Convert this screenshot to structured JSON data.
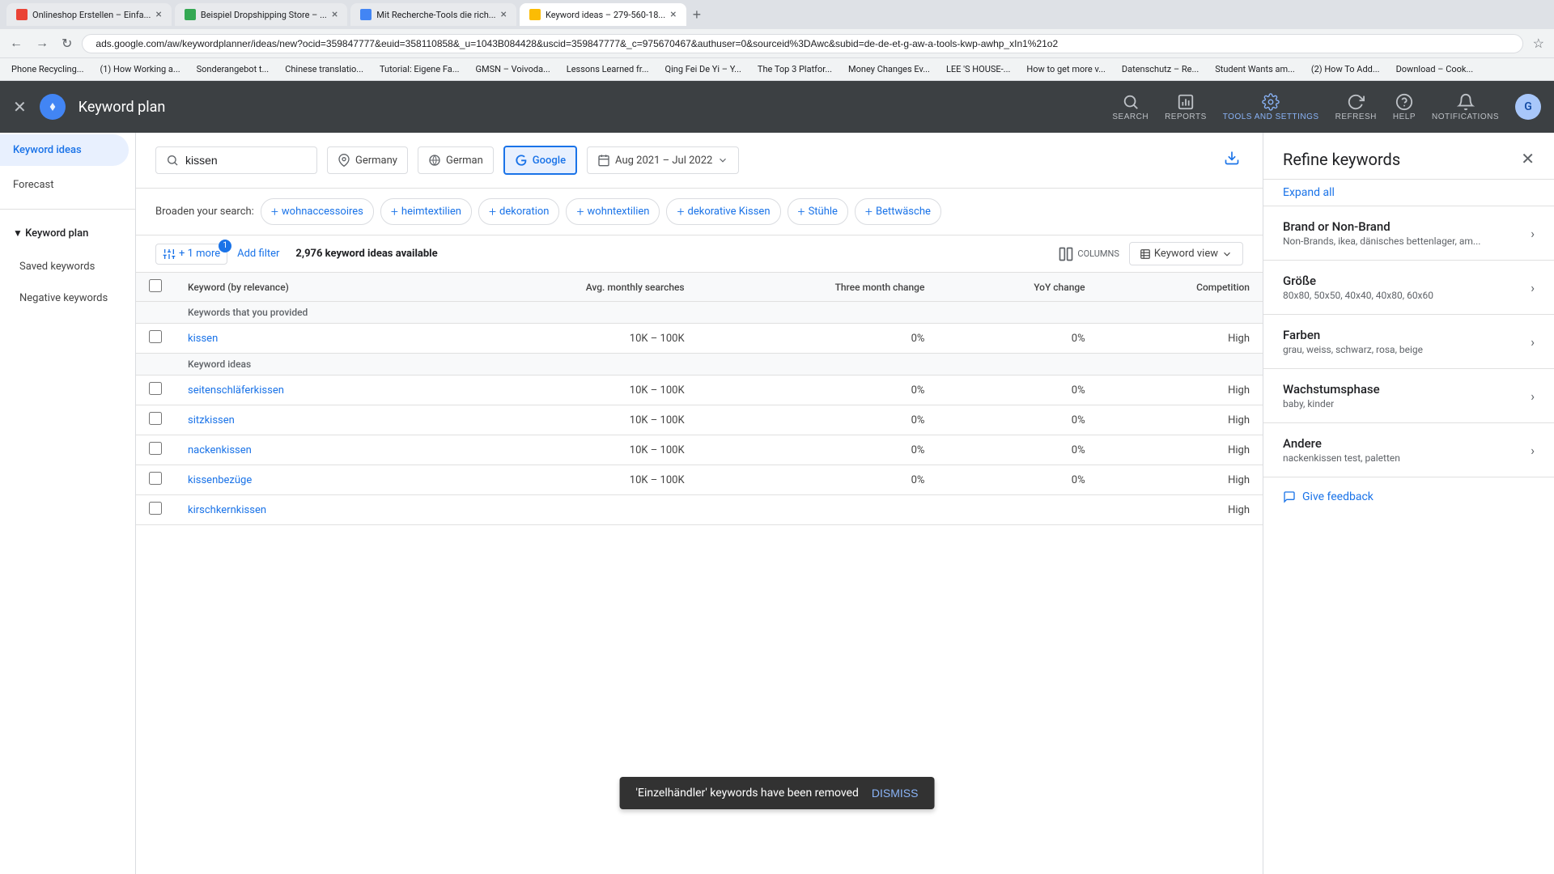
{
  "browser": {
    "tabs": [
      {
        "id": "tab1",
        "title": "Onlineshop Erstellen – Einfa...",
        "active": false
      },
      {
        "id": "tab2",
        "title": "Beispiel Dropshipping Store – ...",
        "active": false
      },
      {
        "id": "tab3",
        "title": "Mit Recherche-Tools die rich...",
        "active": false
      },
      {
        "id": "tab4",
        "title": "Keyword ideas – 279-560-18...",
        "active": true
      }
    ],
    "address": "ads.google.com/aw/keywordplanner/ideas/new?ocid=359847777&euid=358110858&_u=1043B084428&uscid=359847777&_c=975670467&authuser=0&sourceid%3DAwc&subid=de-de-et-g-aw-a-tools-kwp-awhp_xIn1%21o2",
    "bookmarks": [
      "Phone Recycling...",
      "(1) How Working a...",
      "Sonderangebot t...",
      "Chinese translatio...",
      "Tutorial: Eigene Fa...",
      "GMSN – Voivoda...",
      "Lessons Learned fr...",
      "Qing Fei De Yi – Y...",
      "The Top 3 Platfor...",
      "Money Changes Ev...",
      "LEE 'S HOUSE-...",
      "How to get more v...",
      "Datenschutz – Re...",
      "Student Wants am...",
      "(2) How To Add...",
      "Download – Cook..."
    ]
  },
  "header": {
    "title": "Keyword plan",
    "nav": [
      {
        "id": "search",
        "label": "SEARCH"
      },
      {
        "id": "reports",
        "label": "REPORTS"
      },
      {
        "id": "tools",
        "label": "TOOLS AND SETTINGS"
      },
      {
        "id": "refresh",
        "label": "REFRESH"
      },
      {
        "id": "help",
        "label": "HELP"
      },
      {
        "id": "notifications",
        "label": "NOTIFICATIONS"
      }
    ]
  },
  "sidebar": {
    "items": [
      {
        "id": "keyword-ideas",
        "label": "Keyword ideas",
        "active": true
      },
      {
        "id": "forecast",
        "label": "Forecast"
      },
      {
        "id": "keyword-plan",
        "label": "Keyword plan",
        "parent": true
      },
      {
        "id": "saved-keywords",
        "label": "Saved keywords"
      },
      {
        "id": "negative-keywords",
        "label": "Negative keywords"
      }
    ]
  },
  "search_bar": {
    "query": "kissen",
    "location": "Germany",
    "language": "German",
    "network": "Google",
    "date_range": "Aug 2021 – Jul 2022"
  },
  "broaden": {
    "label": "Broaden your search:",
    "tags": [
      "wohnaccessoires",
      "heimtextilien",
      "dekoration",
      "wohntextilien",
      "dekorative Kissen",
      "Stühle",
      "Bettwäsche"
    ]
  },
  "table": {
    "toolbar": {
      "filter_label": "+ 1 more",
      "add_filter": "Add filter",
      "keyword_count": "2,976 keyword ideas available",
      "columns_label": "COLUMNS",
      "view_label": "Keyword view"
    },
    "columns": [
      {
        "id": "keyword",
        "label": "Keyword (by relevance)"
      },
      {
        "id": "avg_monthly",
        "label": "Avg. monthly searches"
      },
      {
        "id": "three_month",
        "label": "Three month change"
      },
      {
        "id": "yoy",
        "label": "YoY change"
      },
      {
        "id": "competition",
        "label": "Competition"
      }
    ],
    "sections": [
      {
        "section_label": "Keywords that you provided",
        "rows": [
          {
            "keyword": "kissen",
            "avg_monthly": "10K – 100K",
            "three_month": "0%",
            "yoy": "0%",
            "competition": "High"
          }
        ]
      },
      {
        "section_label": "Keyword ideas",
        "rows": [
          {
            "keyword": "seitenschläferkissen",
            "avg_monthly": "10K – 100K",
            "three_month": "0%",
            "yoy": "0%",
            "competition": "High"
          },
          {
            "keyword": "sitzkissen",
            "avg_monthly": "10K – 100K",
            "three_month": "0%",
            "yoy": "0%",
            "competition": "High"
          },
          {
            "keyword": "nackenkissen",
            "avg_monthly": "10K – 100K",
            "three_month": "0%",
            "yoy": "0%",
            "competition": "High"
          },
          {
            "keyword": "kissenbezüge",
            "avg_monthly": "10K – 100K",
            "three_month": "0%",
            "yoy": "0%",
            "competition": "High"
          },
          {
            "keyword": "kirschkernkissen",
            "avg_monthly": "",
            "three_month": "",
            "yoy": "",
            "competition": "High"
          }
        ]
      }
    ]
  },
  "refine_panel": {
    "title": "Refine keywords",
    "expand_all": "Expand all",
    "sections": [
      {
        "id": "brand",
        "title": "Brand or Non-Brand",
        "sub": "Non-Brands, ikea, dänisches bettenlager, am..."
      },
      {
        "id": "groesse",
        "title": "Größe",
        "sub": "80x80, 50x50, 40x40, 40x80, 60x60"
      },
      {
        "id": "farben",
        "title": "Farben",
        "sub": "grau, weiss, schwarz, rosa, beige"
      },
      {
        "id": "wachstumsphase",
        "title": "Wachstumsphase",
        "sub": "baby, kinder"
      },
      {
        "id": "andere",
        "title": "Andere",
        "sub": "nackenkissen test, paletten"
      }
    ],
    "feedback": "Give feedback"
  },
  "snackbar": {
    "message": "'Einzelhändler' keywords have been removed",
    "dismiss": "Dismiss"
  }
}
